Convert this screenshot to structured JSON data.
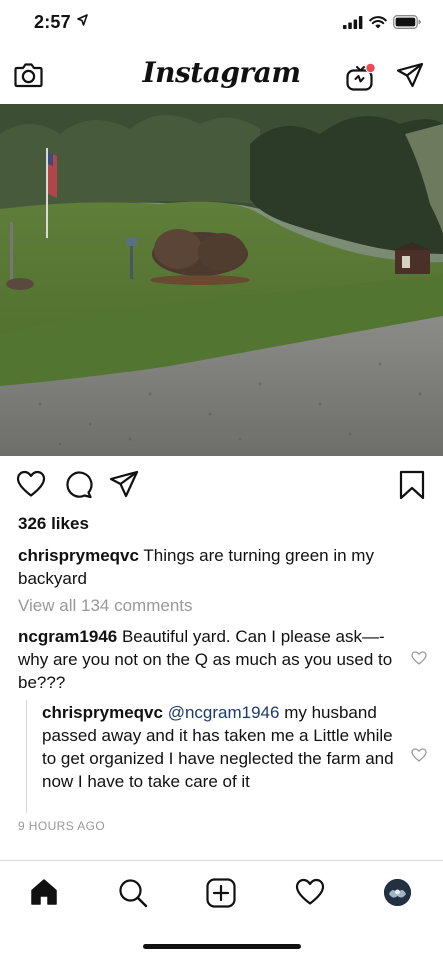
{
  "status_bar": {
    "time": "2:57",
    "location_icon": "location-arrow-icon",
    "signal_icon": "cellular-signal-icon",
    "wifi_icon": "wifi-icon",
    "battery_icon": "battery-icon"
  },
  "header": {
    "title": "Instagram",
    "camera_icon": "camera-icon",
    "igtv_icon": "igtv-icon",
    "direct_icon": "paper-plane-icon"
  },
  "post": {
    "likes": "326 likes",
    "caption": {
      "username": "chrisprymeqvc",
      "text": "Things are turning green in my backyard"
    },
    "view_all": "View all 134 comments",
    "comments": [
      {
        "username": "ncgram1946",
        "text": "Beautiful yard.  Can I please ask—-why are you not on the Q as much as you used to be???"
      }
    ],
    "reply": {
      "username": "chrisprymeqvc",
      "mention": "@ncgram1946",
      "text": "my husband passed away and it has taken me a Little while to get organized I have neglected the farm and now I have to take care of it"
    },
    "timestamp": "9 HOURS AGO"
  },
  "tab_bar": {
    "items": [
      "home-icon",
      "search-icon",
      "add-post-icon",
      "activity-heart-icon",
      "profile-avatar"
    ]
  },
  "colors": {
    "link": "#1d3a6b",
    "muted": "#999999",
    "text": "#111111"
  }
}
